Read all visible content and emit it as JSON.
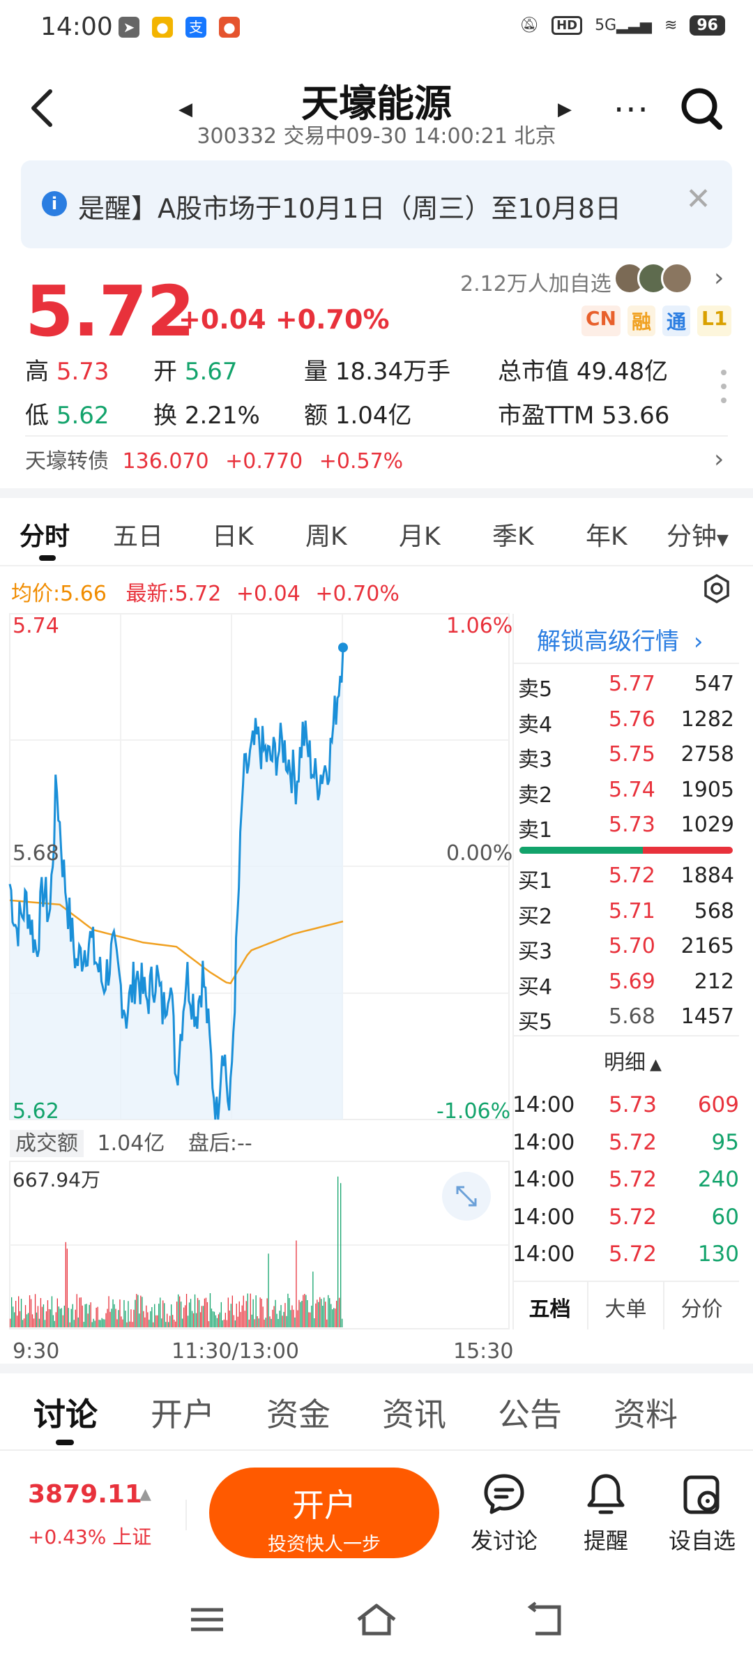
{
  "status_bar": {
    "time": "14:00",
    "network": "5G",
    "hd": "HD",
    "battery": "96"
  },
  "header": {
    "title": "天壕能源",
    "subtitle": "300332 交易中09-30 14:00:21 北京"
  },
  "notice": {
    "text": "是醒】A股市场于10月1日（周三）至10月8日"
  },
  "quote": {
    "price": "5.72",
    "change": "+0.04",
    "change_pct": "+0.70%",
    "followers": "2.12万人加自选",
    "tags": [
      "CN",
      "融",
      "通",
      "L1"
    ]
  },
  "stats": {
    "high_label": "高",
    "high": "5.73",
    "open_label": "开",
    "open": "5.67",
    "volume_label": "量",
    "volume": "18.34万手",
    "mcap_label": "总市值",
    "mcap": "49.48亿",
    "low_label": "低",
    "low": "5.62",
    "turnover_label": "换",
    "turnover": "2.21%",
    "amount_label": "额",
    "amount": "1.04亿",
    "pe_label": "市盈TTM",
    "pe": "53.66"
  },
  "bond": {
    "name": "天壕转债",
    "price": "136.070",
    "change": "+0.770",
    "change_pct": "+0.57%"
  },
  "kline_tabs": [
    "分时",
    "五日",
    "日K",
    "周K",
    "月K",
    "季K",
    "年K",
    "分钟"
  ],
  "chart_header": {
    "avg_label": "均价:",
    "avg": "5.66",
    "latest_label": "最新:",
    "latest": "5.72",
    "change": "+0.04",
    "change_pct": "+0.70%"
  },
  "chart_axes": {
    "y_top": "5.74",
    "y_mid": "5.68",
    "y_bottom": "5.62",
    "pct_top": "1.06%",
    "pct_mid": "0.00%",
    "pct_bottom": "-1.06%",
    "vol_max": "667.94万",
    "time_start": "9:30",
    "time_mid": "11:30/13:00",
    "time_end": "15:30"
  },
  "volume_bar": {
    "label": "成交额",
    "value": "1.04亿",
    "after_hours_label": "盘后:",
    "after_hours_value": "--"
  },
  "order_book": {
    "unlock_label": "解锁高级行情",
    "asks": [
      {
        "label": "卖5",
        "price": "5.77",
        "vol": "547"
      },
      {
        "label": "卖4",
        "price": "5.76",
        "vol": "1282"
      },
      {
        "label": "卖3",
        "price": "5.75",
        "vol": "2758"
      },
      {
        "label": "卖2",
        "price": "5.74",
        "vol": "1905"
      },
      {
        "label": "卖1",
        "price": "5.73",
        "vol": "1029"
      }
    ],
    "bids": [
      {
        "label": "买1",
        "price": "5.72",
        "vol": "1884"
      },
      {
        "label": "买2",
        "price": "5.71",
        "vol": "568"
      },
      {
        "label": "买3",
        "price": "5.70",
        "vol": "2165"
      },
      {
        "label": "买4",
        "price": "5.69",
        "vol": "212"
      },
      {
        "label": "买5",
        "price": "5.68",
        "vol": "1457"
      }
    ],
    "detail_label": "明细",
    "ticks": [
      {
        "time": "14:00",
        "price": "5.73",
        "vol": "609",
        "dir": "buy"
      },
      {
        "time": "14:00",
        "price": "5.72",
        "vol": "95",
        "dir": "sell"
      },
      {
        "time": "14:00",
        "price": "5.72",
        "vol": "240",
        "dir": "sell"
      },
      {
        "time": "14:00",
        "price": "5.72",
        "vol": "60",
        "dir": "sell"
      },
      {
        "time": "14:00",
        "price": "5.72",
        "vol": "130",
        "dir": "sell"
      }
    ],
    "tabs": [
      "五档",
      "大单",
      "分价"
    ],
    "buy_sell_ratio": 0.58
  },
  "bottom_tabs": [
    "讨论",
    "开户",
    "资金",
    "资讯",
    "公告",
    "资料"
  ],
  "bottom_bar": {
    "index_value": "3879.11",
    "index_change": "+0.43% 上证",
    "open_label": "开户",
    "open_sub": "投资快人一步",
    "discuss_label": "发讨论",
    "alert_label": "提醒",
    "watch_label": "设自选"
  },
  "colors": {
    "up": "#e8313b",
    "down": "#12a36b",
    "accent": "#ff5a00",
    "link": "#2a7de1",
    "price_line": "#1a8fd8",
    "avg_line": "#f0a020"
  }
}
